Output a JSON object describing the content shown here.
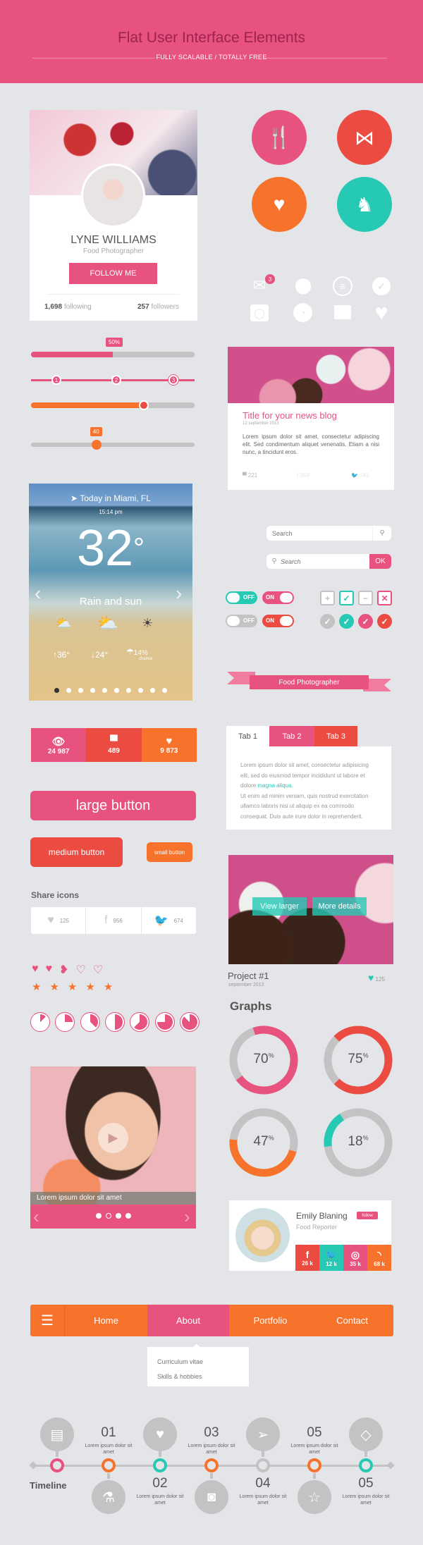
{
  "header": {
    "title": "Flat User Interface Elements",
    "subtitle": "FULLY SCALABLE / TOTALLY FREE"
  },
  "colors": {
    "pink": "#e8527f",
    "red": "#eb4b40",
    "orange": "#f7732b",
    "teal": "#25c9b4",
    "gray": "#c4c2c3",
    "bg": "#e4e5e9"
  },
  "profile": {
    "name": "LYNE WILLIAMS",
    "role": "Food Photographer",
    "follow_label": "FOLLOW ME",
    "following_count": "1,698",
    "following_label": "following",
    "followers_count": "257",
    "followers_label": "followers"
  },
  "big_icons": [
    "fork-spoon-icon",
    "bow-icon",
    "heart-icon",
    "deer-icon"
  ],
  "small_icons": {
    "mail_badge": "3",
    "row1": [
      "mail-icon",
      "location-pin-icon",
      "menu-icon",
      "check-icon"
    ],
    "row2": [
      "camera-icon",
      "clock-icon",
      "chat-icon",
      "heart-icon"
    ]
  },
  "sliders": {
    "s1_value": 50,
    "s1_label": "50%",
    "steps": [
      "1",
      "2",
      "3"
    ],
    "active_step": 3,
    "s3_value": 69,
    "s4_value": 40,
    "s4_label": "40"
  },
  "blog": {
    "title": "Title for your news blog",
    "date": "12 september 2013",
    "text": "Lorem ipsum dolor sit amet, consectetur adipiscing elit. Sed condimentum aliquet venenatis. Etiam a nisi nunc, a tincidunt eros.",
    "comments": "221",
    "facebook": "359",
    "twitter": "741"
  },
  "weather": {
    "location": "Today in Miami, FL",
    "time": "15:14 pm",
    "temp": "32",
    "degree": "°",
    "condition": "Rain and sun",
    "high": "36°",
    "low": "24°",
    "rain": "14%",
    "rain_label": "chance",
    "dots": 10,
    "active_dot": 0
  },
  "search": {
    "placeholder1": "Search",
    "placeholder2": "Search",
    "ok_label": "OK"
  },
  "toggles": [
    {
      "label": "OFF",
      "state": "off",
      "color": "#25c9b4"
    },
    {
      "label": "ON",
      "state": "on",
      "color": "#e8527f"
    },
    {
      "label": "OFF",
      "state": "off",
      "color": "#c4c2c3"
    },
    {
      "label": "ON",
      "state": "on",
      "color": "#eb4b40"
    }
  ],
  "checkboxes": [
    {
      "glyph": "+",
      "color": "#c4c2c3"
    },
    {
      "glyph": "✓",
      "color": "#25c9b4"
    },
    {
      "glyph": "−",
      "color": "#c4c2c3"
    },
    {
      "glyph": "✕",
      "color": "#e8527f"
    }
  ],
  "round_checks": [
    "#c4c2c3",
    "#25c9b4",
    "#e8527f",
    "#eb4b40"
  ],
  "ribbon": {
    "label": "Food Photographer"
  },
  "stats": [
    {
      "icon": "eye-icon",
      "value": "24 987"
    },
    {
      "icon": "chat-icon",
      "value": "489"
    },
    {
      "icon": "heart-icon",
      "value": "9 873"
    }
  ],
  "tabs": {
    "items": [
      "Tab 1",
      "Tab 2",
      "Tab 3"
    ],
    "active": 0,
    "text1": "Lorem ipsum dolor sit amet, consectetur adipisicing elit, sed do eiusmod tempor incididunt ut labore et dolore ",
    "link": "magna aliqua",
    "text1_end": ".",
    "text2": "Ut enim ad minim veniam, quis nostrud exercitation ullamco laboris nisi ut aliquip ex ea commodo consequat. Duis aute irure dolor in reprehenderit."
  },
  "buttons": {
    "large": "large button",
    "medium": "medium button",
    "small": "small button"
  },
  "share": {
    "title": "Share icons",
    "items": [
      {
        "icon": "heart-icon",
        "count": "125"
      },
      {
        "icon": "facebook-icon",
        "count": "956"
      },
      {
        "icon": "twitter-icon",
        "count": "674"
      }
    ]
  },
  "rating": {
    "hearts": 2.5,
    "hearts_max": 5,
    "stars": 5,
    "stars_max": 5
  },
  "pie_clocks": [
    0.125,
    0.25,
    0.375,
    0.5,
    0.625,
    0.75,
    0.875
  ],
  "project": {
    "view_label": "View larger",
    "details_label": "More details",
    "title": "Project #1",
    "date": "september 2012",
    "likes": "125"
  },
  "graphs": {
    "title": "Graphs",
    "items": [
      {
        "value": 70,
        "label": "70",
        "color": "#e8527f"
      },
      {
        "value": 75,
        "label": "75",
        "color": "#eb4b40"
      },
      {
        "value": 47,
        "label": "47",
        "color": "#f7732b"
      },
      {
        "value": 18,
        "label": "18",
        "color": "#25c9b4"
      }
    ],
    "unit": "%"
  },
  "video": {
    "caption": "Lorem ipsum dolor sit amet",
    "dots": 4,
    "active_dot": 1
  },
  "emily": {
    "name": "Emily Blaning",
    "follow_label": "follow",
    "role": "Food Reporter",
    "social": [
      {
        "icon": "facebook-icon",
        "count": "26 k",
        "color": "#eb4b40"
      },
      {
        "icon": "twitter-icon",
        "count": "12 k",
        "color": "#25c9b4"
      },
      {
        "icon": "dribbble-icon",
        "count": "35 k",
        "color": "#e8527f"
      },
      {
        "icon": "rss-icon",
        "count": "68 k",
        "color": "#f7732b"
      }
    ]
  },
  "nav": {
    "items": [
      "Home",
      "About",
      "Portfolio",
      "Contact"
    ],
    "active": 1,
    "dropdown": [
      "Curriculum vitae",
      "Skills & hobbies"
    ]
  },
  "timeline": {
    "label": "Timeline",
    "top_numbers": [
      "01",
      "03",
      "05"
    ],
    "bottom_numbers": [
      "02",
      "04",
      "05"
    ],
    "item_text": "Lorem ipsum dolor sit amet",
    "top_icons": [
      "newspaper-icon",
      "heart-icon",
      "paper-plane-icon",
      "diamond-icon"
    ],
    "bottom_icons": [
      "flask-icon",
      "camera-icon",
      "star-icon"
    ],
    "dot_colors": [
      "#e8527f",
      "#f7732b",
      "#25c9b4",
      "#f7732b",
      "#c4c2c3",
      "#f7732b",
      "#25c9b4"
    ]
  }
}
